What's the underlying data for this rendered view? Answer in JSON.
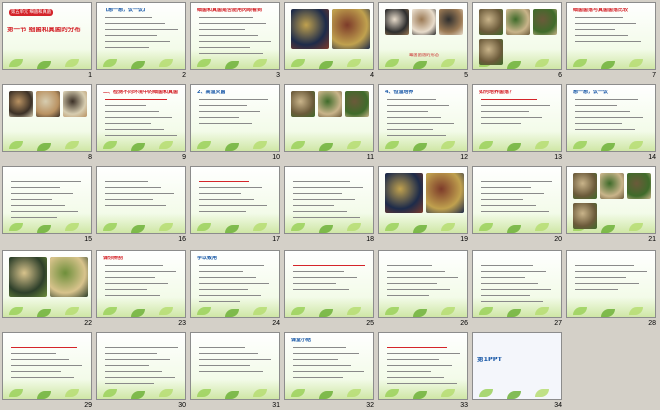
{
  "slides": [
    {
      "n": "1",
      "kind": "title",
      "title": "第一节 细菌和真菌的分布",
      "badge": "第五单元 细菌和真菌"
    },
    {
      "n": "2",
      "kind": "text",
      "title": "【想一想，议一议】"
    },
    {
      "n": "3",
      "kind": "text",
      "title": "细菌和真菌是否能用肉眼看到"
    },
    {
      "n": "4",
      "kind": "photo"
    },
    {
      "n": "5",
      "kind": "photo",
      "caption": "霉菌菌落的形态"
    },
    {
      "n": "6",
      "kind": "photo"
    },
    {
      "n": "7",
      "kind": "text",
      "title": "细菌菌落与真菌菌落比较"
    },
    {
      "n": "8",
      "kind": "photo"
    },
    {
      "n": "9",
      "kind": "text",
      "title": "二、检测不同环境中的细菌和真菌"
    },
    {
      "n": "10",
      "kind": "text",
      "title": "2、高温灭菌"
    },
    {
      "n": "11",
      "kind": "photo"
    },
    {
      "n": "12",
      "kind": "text",
      "title": "4、恒温培养"
    },
    {
      "n": "13",
      "kind": "text",
      "title": "如何培养菌落？"
    },
    {
      "n": "14",
      "kind": "text",
      "title": "想一想，议一议"
    },
    {
      "n": "15",
      "kind": "text"
    },
    {
      "n": "16",
      "kind": "text"
    },
    {
      "n": "17",
      "kind": "text"
    },
    {
      "n": "18",
      "kind": "text"
    },
    {
      "n": "19",
      "kind": "photo"
    },
    {
      "n": "20",
      "kind": "text"
    },
    {
      "n": "21",
      "kind": "photo"
    },
    {
      "n": "22",
      "kind": "photo"
    },
    {
      "n": "23",
      "kind": "text",
      "title": "课你辨别"
    },
    {
      "n": "24",
      "kind": "text",
      "title": "学以致用"
    },
    {
      "n": "25",
      "kind": "text"
    },
    {
      "n": "26",
      "kind": "text"
    },
    {
      "n": "27",
      "kind": "text"
    },
    {
      "n": "28",
      "kind": "text"
    },
    {
      "n": "29",
      "kind": "text"
    },
    {
      "n": "30",
      "kind": "text"
    },
    {
      "n": "31",
      "kind": "text"
    },
    {
      "n": "32",
      "kind": "text",
      "title": "课堂小结"
    },
    {
      "n": "33",
      "kind": "text"
    },
    {
      "n": "34",
      "kind": "title",
      "title": "第1PPT"
    }
  ],
  "colors": {
    "accent": "#3b6bd6",
    "green": "#7fbf45",
    "red": "#d4242a"
  }
}
